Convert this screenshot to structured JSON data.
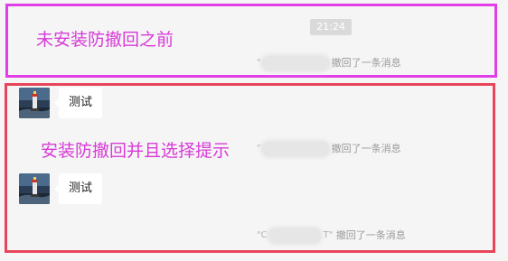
{
  "annotations": {
    "before_install": "未安装防撤回之前",
    "after_install": "安装防撤回并且选择提示"
  },
  "chat": {
    "timestamp": "21:24",
    "recall_notice": "撤回了一条消息",
    "quote_open": "\"",
    "quote_last_visible": "\"C",
    "quote_close_visible": "T\"",
    "messages": [
      {
        "text": "测试"
      },
      {
        "text": "测试"
      }
    ]
  },
  "colors": {
    "frame_top_border": "#e23ee8",
    "frame_bottom_border": "#e8455a",
    "annotation_text": "#d83ad8",
    "chat_background": "#f5f5f5",
    "bubble": "#ffffff"
  },
  "icons": {
    "avatar": "lighthouse-avatar-icon"
  }
}
